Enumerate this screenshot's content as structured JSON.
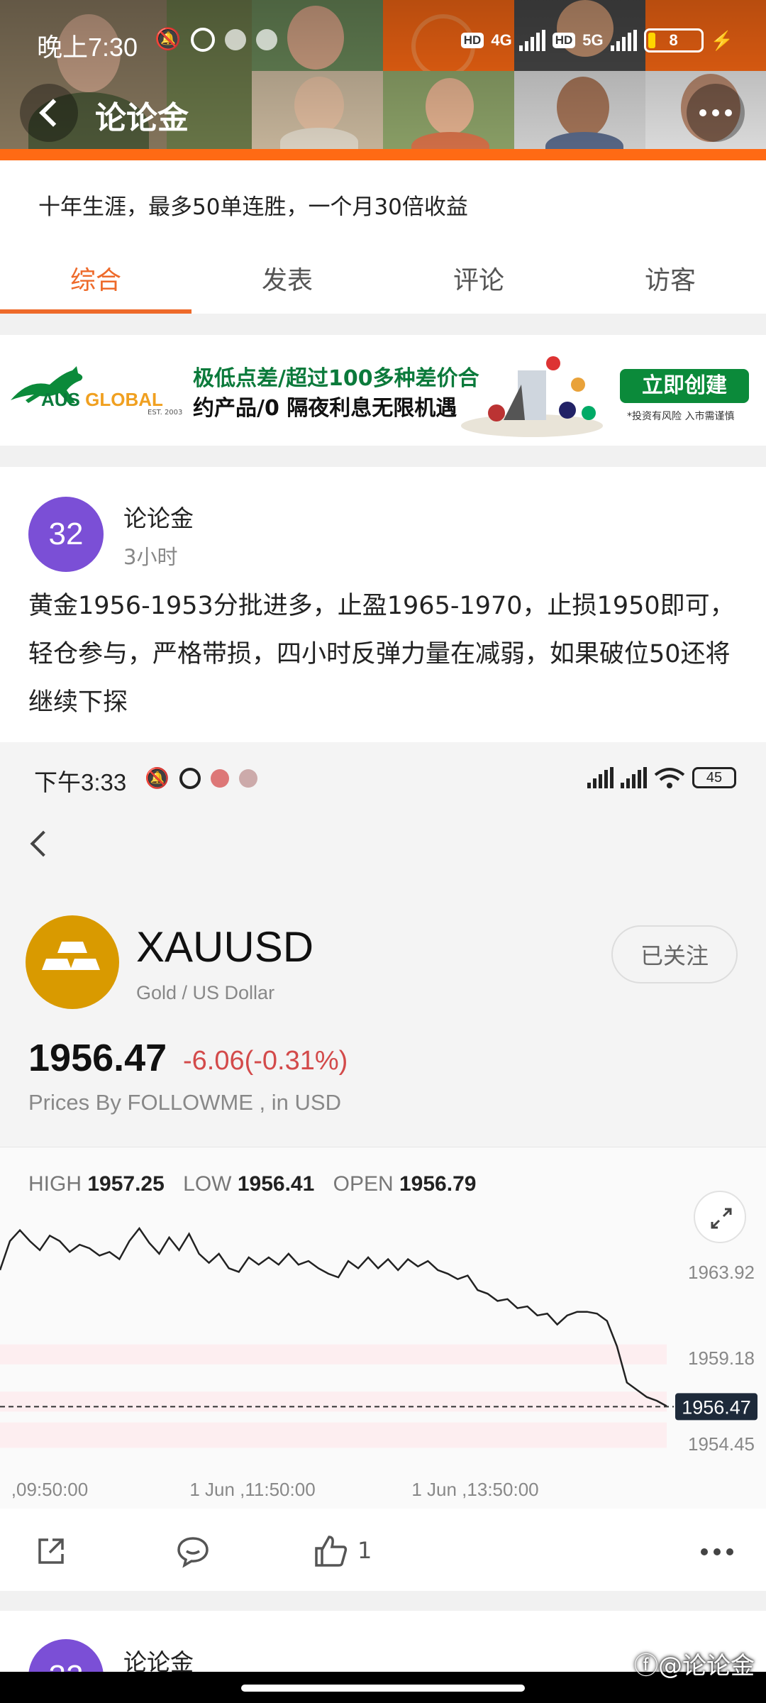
{
  "status_bar": {
    "time": "晚上7:30",
    "net1": "4G",
    "net2": "5G",
    "hd": "HD",
    "battery": "8"
  },
  "header": {
    "title": "论论金"
  },
  "profile": {
    "bio": "十年生涯，最多50单连胜，一个月30倍收益"
  },
  "tabs": [
    {
      "label": "综合",
      "active": true
    },
    {
      "label": "发表",
      "active": false
    },
    {
      "label": "评论",
      "active": false
    },
    {
      "label": "访客",
      "active": false
    }
  ],
  "ad": {
    "brand_main": "AUS",
    "brand_sub": "GLOBAL",
    "est": "EST. 2003",
    "line1": "极低点差/超过100多种差价合",
    "line2": "约产品/0 隔夜利息无限机遇",
    "button": "立即创建",
    "note": "*投资有风险 入市需谨慎",
    "colors": {
      "green": "#0b8a3a",
      "orange": "#f0a020"
    }
  },
  "post": {
    "avatar_text": "32",
    "author": "论论金",
    "time": "3小时",
    "text": "黄金1956-1953分批进多，止盈1965-1970，止损1950即可，轻仓参与，严格带损，四小时反弹力量在减弱，如果破位50还将继续下探",
    "likes": "1"
  },
  "screenshot": {
    "status_time": "下午3:33",
    "battery": "45",
    "symbol": "XAUUSD",
    "symbol_desc": "Gold / US Dollar",
    "follow_label": "已关注",
    "price": "1956.47",
    "change": "-6.06(-0.31%)",
    "source": "Prices By FOLLOWME , in USD",
    "high_label": "HIGH",
    "high": "1957.25",
    "low_label": "LOW",
    "low": "1956.41",
    "open_label": "OPEN",
    "open": "1956.79",
    "colors": {
      "down": "#d34a4a",
      "gold": "#d99a00"
    }
  },
  "chart_data": {
    "type": "line",
    "x_ticks": [
      ",09:50:00",
      "1 Jun ,11:50:00",
      "1 Jun ,13:50:00"
    ],
    "y_ticks": [
      1963.92,
      1959.18,
      1954.45
    ],
    "last_price_label": "1956.47",
    "ylim": [
      1953.2,
      1966.5
    ],
    "series": [
      {
        "values": [
          1964.0,
          1965.6,
          1966.2,
          1965.6,
          1965.1,
          1965.9,
          1965.6,
          1965.0,
          1965.4,
          1965.2,
          1964.8,
          1965.0,
          1964.6,
          1965.6,
          1966.3,
          1965.5,
          1964.9,
          1965.8,
          1965.1,
          1966.0,
          1964.9,
          1964.4,
          1964.9,
          1964.1,
          1963.9,
          1964.7,
          1964.3,
          1964.7,
          1964.3,
          1964.9,
          1964.3,
          1964.5,
          1964.1,
          1963.8,
          1963.6,
          1964.5,
          1964.1,
          1964.7,
          1964.1,
          1964.6,
          1964.0,
          1964.6,
          1964.2,
          1964.5,
          1964.0,
          1963.8,
          1963.5,
          1963.7,
          1962.9,
          1962.7,
          1962.3,
          1962.4,
          1961.9,
          1962.0,
          1961.5,
          1961.6,
          1961.0,
          1961.5,
          1961.7,
          1961.7,
          1961.6,
          1961.2,
          1959.8,
          1957.8,
          1957.4,
          1957.0,
          1956.8,
          1956.5
        ]
      }
    ],
    "grid": false,
    "legend": "none"
  }
}
